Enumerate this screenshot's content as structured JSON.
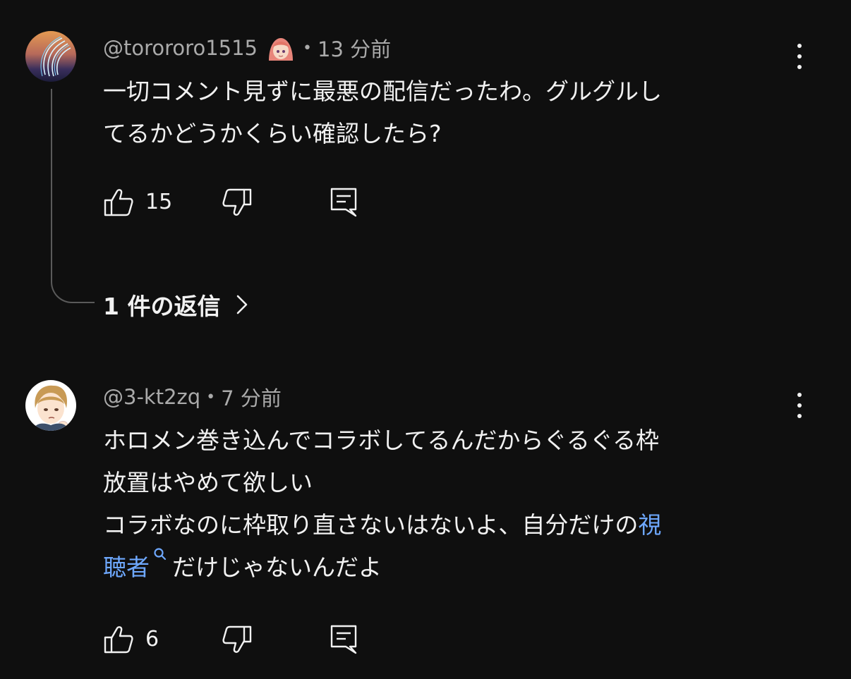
{
  "comments": [
    {
      "handle": "@torororo1515",
      "separator": "•",
      "time": "13 分前",
      "lines": [
        "一切コメント見ずに最悪の配信だったわ。グルグルし",
        "てるかどうかくらい確認したら?"
      ],
      "likes": "15",
      "replies_label": "1 件の返信"
    },
    {
      "handle": "@3-kt2zq",
      "separator": "•",
      "time": "7 分前",
      "lines": [
        "ホロメン巻き込んでコラボしてるんだからぐるぐる枠",
        "放置はやめて欲しい"
      ],
      "line3_pre": "コラボなのに枠取り直さないはないよ、自分だけの",
      "link_part1": "視",
      "link_part2": "聴者",
      "line4_post": "だけじゃないんだよ",
      "likes": "6"
    }
  ],
  "colors": {
    "background": "#0f0f0f",
    "text": "#f1f1f1",
    "meta": "#aaaaaa",
    "link": "#6ea8fe"
  },
  "icons": {
    "like": "thumbs-up-icon",
    "dislike": "thumbs-down-icon",
    "reply": "reply-comment-icon",
    "more": "more-vertical-icon",
    "chevron": "chevron-right-icon",
    "search": "search-icon"
  }
}
